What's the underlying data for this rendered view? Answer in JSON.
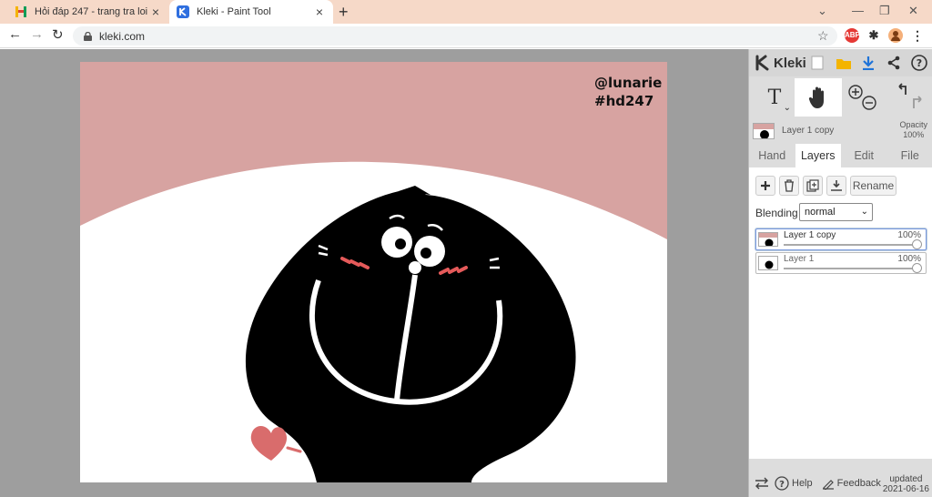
{
  "browser": {
    "tabs": [
      {
        "title": "Hỏi đáp 247 - trang tra loi",
        "favicon": "hd247-favicon",
        "active": false
      },
      {
        "title": "Kleki - Paint Tool",
        "favicon": "kleki-favicon",
        "active": true
      }
    ],
    "url": "kleki.com",
    "extensions": [
      {
        "name": "adblock-icon",
        "label": "ABP",
        "color": "#e53935"
      },
      {
        "name": "puzzle-icon"
      },
      {
        "name": "profile-avatar-icon"
      }
    ]
  },
  "canvas": {
    "watermark_line1": "@lunarie",
    "watermark_line2": "#hd247",
    "colors": {
      "background": "#d7a3a1",
      "blanket": "#ffffff",
      "character": "#000000",
      "blush": "#e55a5a",
      "heart": "#d96c6c"
    }
  },
  "panel": {
    "brand": "Kleki",
    "header_icons": [
      "new-image-icon",
      "open-folder-icon",
      "download-icon",
      "share-icon",
      "help-icon"
    ],
    "tools": [
      {
        "name": "text-tool",
        "label": "T"
      },
      {
        "name": "hand-tool"
      },
      {
        "name": "zoom-tool"
      },
      {
        "name": "undo-redo"
      }
    ],
    "active_layer": {
      "name": "Layer 1 copy",
      "opacity_label": "Opacity",
      "opacity": "100%"
    },
    "tabs": [
      "Hand",
      "Layers",
      "Edit",
      "File"
    ],
    "active_tab": "Layers",
    "layer_buttons": {
      "rename": "Rename"
    },
    "blending": {
      "label": "Blending",
      "value": "normal"
    },
    "layers": [
      {
        "name": "Layer 1 copy",
        "opacity": "100%",
        "selected": true
      },
      {
        "name": "Layer 1",
        "opacity": "100%",
        "selected": false
      }
    ],
    "footer": {
      "help": "Help",
      "feedback": "Feedback",
      "updated_label": "updated",
      "updated_date": "2021-06-16"
    }
  }
}
